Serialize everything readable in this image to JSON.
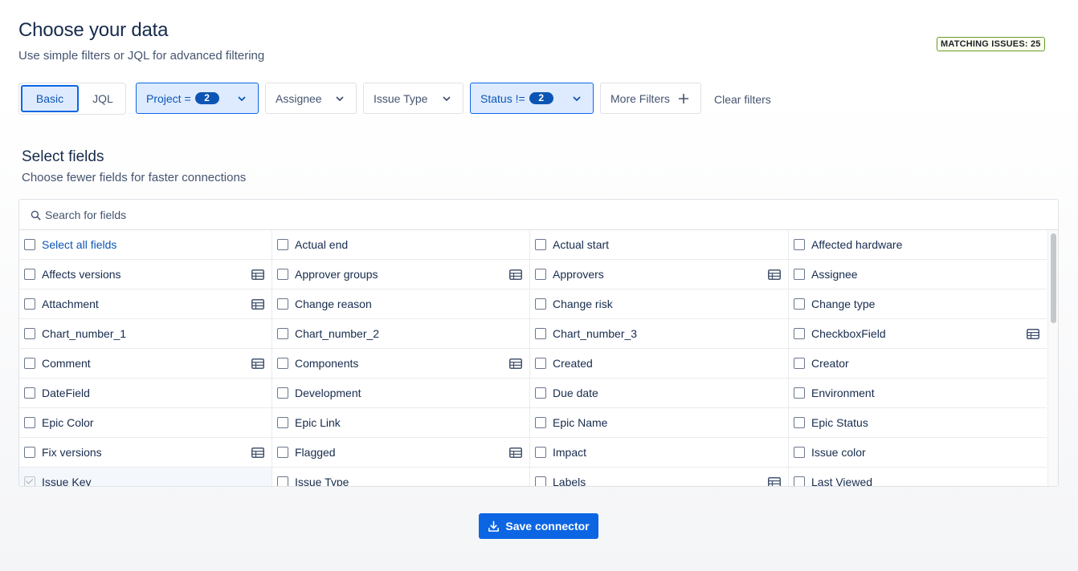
{
  "header": {
    "title": "Choose your data",
    "subtitle": "Use simple filters or JQL for advanced filtering",
    "matching_issues": "MATCHING ISSUES: 25"
  },
  "mode_toggle": {
    "basic": "Basic",
    "jql": "JQL",
    "selected": "Basic"
  },
  "filters": {
    "project": {
      "label": "Project =",
      "count": "2"
    },
    "assignee": {
      "label": "Assignee"
    },
    "issue_type": {
      "label": "Issue Type"
    },
    "status": {
      "label": "Status !=",
      "count": "2"
    },
    "more_filters": {
      "label": "More Filters"
    },
    "clear": "Clear filters"
  },
  "fields_section": {
    "title": "Select fields",
    "subtitle": "Choose fewer fields for faster connections",
    "search_placeholder": "Search for fields",
    "rows": [
      [
        {
          "label": "Select all fields",
          "table_icon": false,
          "link": true
        },
        {
          "label": "Actual end",
          "table_icon": false
        },
        {
          "label": "Actual start",
          "table_icon": false
        },
        {
          "label": "Affected hardware",
          "table_icon": false
        }
      ],
      [
        {
          "label": "Affects versions",
          "table_icon": true
        },
        {
          "label": "Approver groups",
          "table_icon": true
        },
        {
          "label": "Approvers",
          "table_icon": true
        },
        {
          "label": "Assignee",
          "table_icon": false
        }
      ],
      [
        {
          "label": "Attachment",
          "table_icon": true
        },
        {
          "label": "Change reason",
          "table_icon": false
        },
        {
          "label": "Change risk",
          "table_icon": false
        },
        {
          "label": "Change type",
          "table_icon": false
        }
      ],
      [
        {
          "label": "Chart_number_1",
          "table_icon": false
        },
        {
          "label": "Chart_number_2",
          "table_icon": false
        },
        {
          "label": "Chart_number_3",
          "table_icon": false
        },
        {
          "label": "CheckboxField",
          "table_icon": true
        }
      ],
      [
        {
          "label": "Comment",
          "table_icon": true
        },
        {
          "label": "Components",
          "table_icon": true
        },
        {
          "label": "Created",
          "table_icon": false
        },
        {
          "label": "Creator",
          "table_icon": false
        }
      ],
      [
        {
          "label": "DateField",
          "table_icon": false
        },
        {
          "label": "Development",
          "table_icon": false
        },
        {
          "label": "Due date",
          "table_icon": false
        },
        {
          "label": "Environment",
          "table_icon": false
        }
      ],
      [
        {
          "label": "Epic Color",
          "table_icon": false
        },
        {
          "label": "Epic Link",
          "table_icon": false
        },
        {
          "label": "Epic Name",
          "table_icon": false
        },
        {
          "label": "Epic Status",
          "table_icon": false
        }
      ],
      [
        {
          "label": "Fix versions",
          "table_icon": true
        },
        {
          "label": "Flagged",
          "table_icon": true
        },
        {
          "label": "Impact",
          "table_icon": false
        },
        {
          "label": "Issue color",
          "table_icon": false
        }
      ],
      [
        {
          "label": "Issue Key",
          "table_icon": false,
          "checked_disabled": true
        },
        {
          "label": "Issue Type",
          "table_icon": false
        },
        {
          "label": "Labels",
          "table_icon": true
        },
        {
          "label": "Last Viewed",
          "table_icon": false
        }
      ]
    ]
  },
  "save_button": {
    "label": "Save connector"
  },
  "colors": {
    "accent": "#0c66e4",
    "accent_light": "#deebff",
    "badge_border": "#6a9a23"
  }
}
